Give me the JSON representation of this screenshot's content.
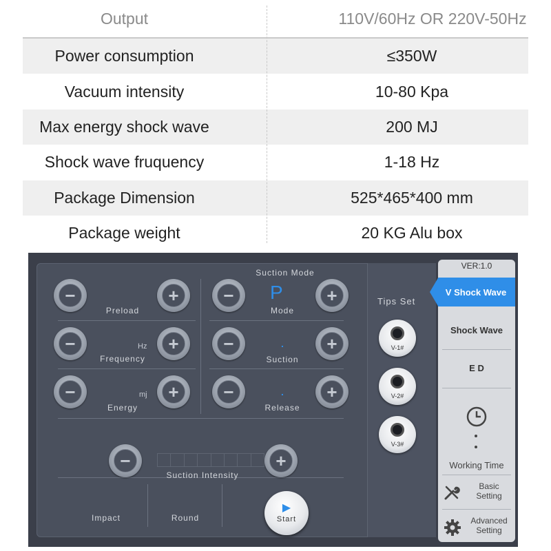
{
  "spec_table": {
    "header": {
      "label": "Output",
      "value": "110V/60Hz OR 220V-50Hz"
    },
    "rows": [
      {
        "label": "Power consumption",
        "value": "≤350W"
      },
      {
        "label": "Vacuum intensity",
        "value": "10-80 Kpa"
      },
      {
        "label": "Max energy shock wave",
        "value": "200 MJ"
      },
      {
        "label": "Shock wave fruquency",
        "value": "1-18 Hz"
      },
      {
        "label": "Package Dimension",
        "value": "525*465*400 mm"
      },
      {
        "label": "Package weight",
        "value": "20 KG Alu box"
      }
    ]
  },
  "device": {
    "suction_mode_title": "Suction Mode",
    "controls": {
      "preload": "Preload",
      "frequency": "Frequency",
      "frequency_unit": "Hz",
      "energy": "Energy",
      "energy_unit": "mj",
      "mode": "Mode",
      "mode_value": "P",
      "suction": "Suction",
      "release": "Release",
      "dot": ".",
      "suction_intensity": "Suction Intensity",
      "impact": "Impact",
      "round": "Round",
      "start": "Start",
      "plus": "+",
      "minus": "−"
    },
    "tips": {
      "title": "Tips Set",
      "items": [
        "V-1#",
        "V-2#",
        "V-3#"
      ]
    },
    "menu": {
      "version": "VER:1.0",
      "active_tab": "V Shock Wave",
      "shock_wave": "Shock Wave",
      "ed": "E D",
      "working_time": "Working Time",
      "basic_setting": "Basic Setting",
      "advanced_setting": "Advanced Setting"
    },
    "colors": {
      "accent": "#2f8ee8",
      "panel": "#4a505d",
      "background": "#3b3f4a",
      "menu": "#d9dbdf"
    }
  }
}
